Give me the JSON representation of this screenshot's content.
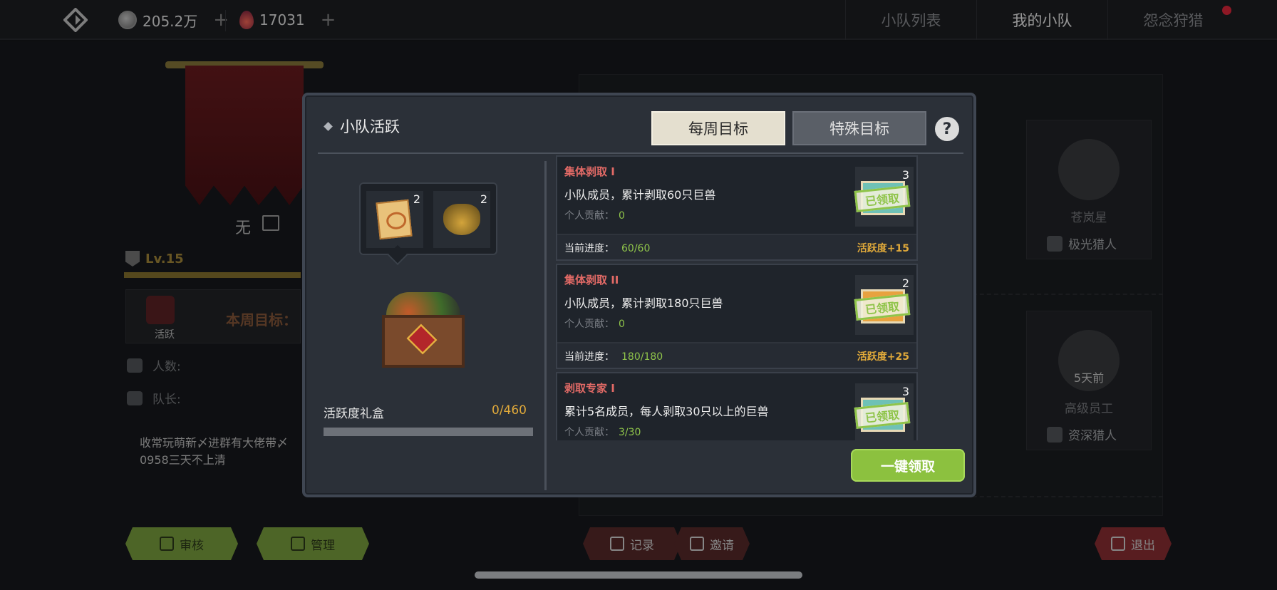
{
  "topbar": {
    "coins": "205.2万",
    "gems": "17031",
    "plus": "+",
    "tabs": [
      {
        "label": "小队列表"
      },
      {
        "label": "我的小队"
      },
      {
        "label": "怨念狩猎"
      }
    ]
  },
  "team": {
    "name": "无",
    "level": "Lv.15",
    "weekly_card_label": "活跃",
    "weekly_goal_title": "本周目标：",
    "members_label": "人数:",
    "leader_label": "队长:",
    "description": "收常玩萌新〆进群有大佬带〆0958三天不上清"
  },
  "bottom_buttons": {
    "review": "审核",
    "manage": "管理",
    "record": "记录",
    "invite": "邀请",
    "quit": "退出"
  },
  "members": [
    {
      "name": "苍岚星",
      "role": "极光猎人",
      "since": ""
    },
    {
      "name": "高级员工",
      "role": "资深猎人",
      "since": "5天前"
    }
  ],
  "modal": {
    "title": "小队活跃",
    "tabs": {
      "weekly": "每周目标",
      "special": "特殊目标"
    },
    "help": "?",
    "rewards": [
      {
        "icon": "scroll-icon",
        "count": "2"
      },
      {
        "icon": "mask-icon",
        "count": "2"
      }
    ],
    "gift_label": "活跃度礼盒",
    "gift_value": "0/460",
    "gift_progress": 0,
    "tasks": [
      {
        "name": "集体剥取 I",
        "desc": "小队成员，累计剥取60只巨兽",
        "contrib_label": "个人贡献：",
        "contrib_value": "0",
        "progress_label": "当前进度：",
        "progress_value": "60/60",
        "activity": "活跃度+15",
        "reward_count": "3",
        "stamp": "已领取"
      },
      {
        "name": "集体剥取 II",
        "desc": "小队成员，累计剥取180只巨兽",
        "contrib_label": "个人贡献：",
        "contrib_value": "0",
        "progress_label": "当前进度：",
        "progress_value": "180/180",
        "activity": "活跃度+25",
        "reward_count": "2",
        "stamp": "已领取"
      },
      {
        "name": "剥取专家 I",
        "desc": "累计5名成员，每人剥取30只以上的巨兽",
        "contrib_label": "个人贡献：",
        "contrib_value": "3/30",
        "progress_label": "",
        "progress_value": "",
        "activity": "",
        "reward_count": "3",
        "stamp": "已领取"
      }
    ],
    "claim_all": "一键领取"
  }
}
